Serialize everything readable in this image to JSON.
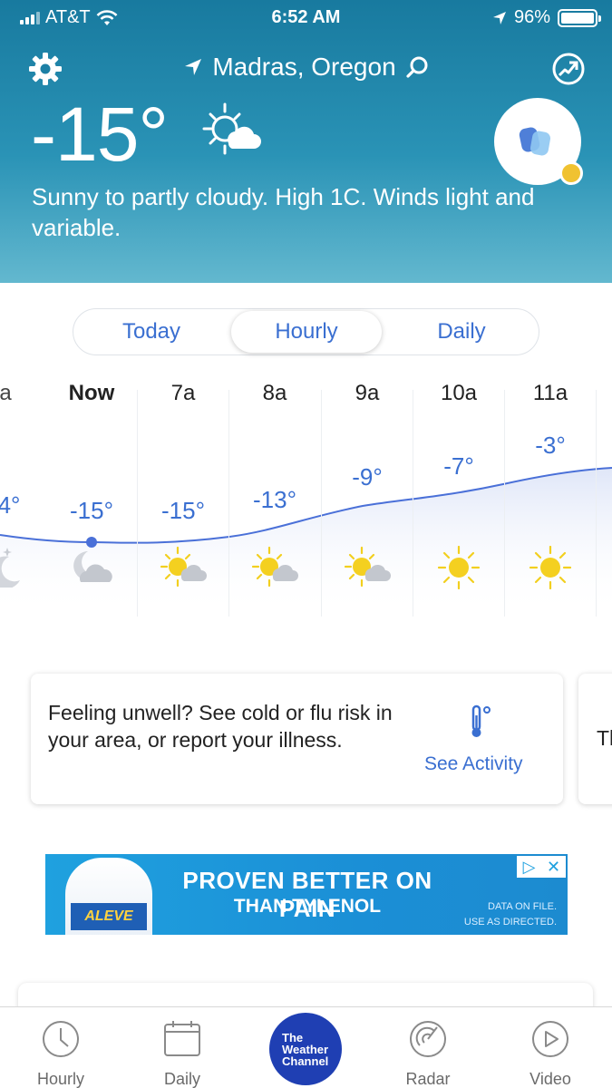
{
  "status_bar": {
    "carrier": "AT&T",
    "time": "6:52 AM",
    "battery": "96%"
  },
  "header": {
    "location": "Madras, Oregon",
    "temperature": "-15°",
    "description": "Sunny to partly cloudy. High 1C. Winds light and variable."
  },
  "tabs": [
    {
      "label": "Today"
    },
    {
      "label": "Hourly",
      "active": true
    },
    {
      "label": "Daily"
    }
  ],
  "hourly": [
    {
      "label": "a",
      "temp": "4°",
      "icon": "clear-night-icon"
    },
    {
      "label": "Now",
      "temp": "-15°",
      "icon": "partly-cloudy-night-icon"
    },
    {
      "label": "7a",
      "temp": "-15°",
      "icon": "partly-sunny-icon"
    },
    {
      "label": "8a",
      "temp": "-13°",
      "icon": "partly-sunny-icon"
    },
    {
      "label": "9a",
      "temp": "-9°",
      "icon": "partly-sunny-icon"
    },
    {
      "label": "10a",
      "temp": "-7°",
      "icon": "sunny-icon"
    },
    {
      "label": "11a",
      "temp": "-3°",
      "icon": "sunny-icon"
    }
  ],
  "card": {
    "text": "Feeling unwell? See cold or flu risk in your area, or report your illness.",
    "link": "See Activity",
    "next_card_text": "Th"
  },
  "ad": {
    "brand": "ALEVE",
    "headline": "PROVEN BETTER ON PAIN",
    "subheadline": "THAN TYLENOL",
    "fine_print_1": "DATA ON FILE.",
    "fine_print_2": "USE AS DIRECTED."
  },
  "nav": {
    "hourly": "Hourly",
    "daily": "Daily",
    "brand": "The Weather Channel",
    "brand_line1": "The",
    "brand_line2": "Weather",
    "brand_line3": "Channel",
    "radar": "Radar",
    "video": "Video"
  },
  "colors": {
    "accent": "#3a6fd1",
    "header_top": "#187a9f",
    "header_bottom": "#63b8cf",
    "sun": "#f4d020"
  }
}
